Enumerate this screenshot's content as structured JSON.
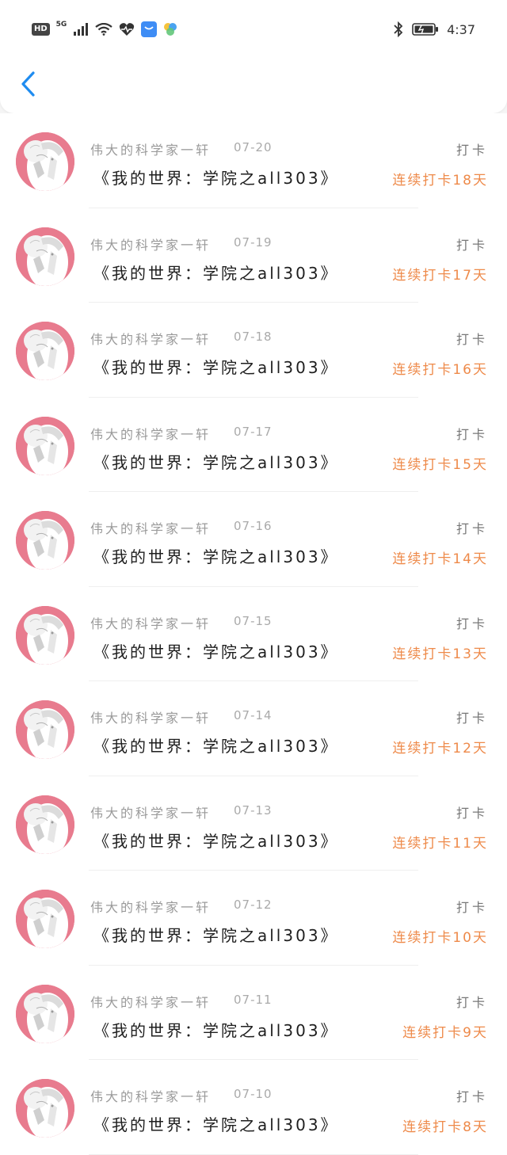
{
  "status_bar": {
    "hd": "HD",
    "network": "5G",
    "time": "4:37"
  },
  "colors": {
    "accent_blue": "#1f8cf0",
    "streak_orange": "#ee8a4a",
    "avatar_pink": "#e87b8e"
  },
  "icons": {
    "back": "chevron-left-icon",
    "avatar": "avatar"
  },
  "checkins": [
    {
      "author": "伟大的科学家一轩",
      "date": "07-20",
      "title": "《我的世界：学院之all303》",
      "action": "打卡",
      "streak": "连续打卡18天"
    },
    {
      "author": "伟大的科学家一轩",
      "date": "07-19",
      "title": "《我的世界：学院之all303》",
      "action": "打卡",
      "streak": "连续打卡17天"
    },
    {
      "author": "伟大的科学家一轩",
      "date": "07-18",
      "title": "《我的世界：学院之all303》",
      "action": "打卡",
      "streak": "连续打卡16天"
    },
    {
      "author": "伟大的科学家一轩",
      "date": "07-17",
      "title": "《我的世界：学院之all303》",
      "action": "打卡",
      "streak": "连续打卡15天"
    },
    {
      "author": "伟大的科学家一轩",
      "date": "07-16",
      "title": "《我的世界：学院之all303》",
      "action": "打卡",
      "streak": "连续打卡14天"
    },
    {
      "author": "伟大的科学家一轩",
      "date": "07-15",
      "title": "《我的世界：学院之all303》",
      "action": "打卡",
      "streak": "连续打卡13天"
    },
    {
      "author": "伟大的科学家一轩",
      "date": "07-14",
      "title": "《我的世界：学院之all303》",
      "action": "打卡",
      "streak": "连续打卡12天"
    },
    {
      "author": "伟大的科学家一轩",
      "date": "07-13",
      "title": "《我的世界：学院之all303》",
      "action": "打卡",
      "streak": "连续打卡11天"
    },
    {
      "author": "伟大的科学家一轩",
      "date": "07-12",
      "title": "《我的世界：学院之all303》",
      "action": "打卡",
      "streak": "连续打卡10天"
    },
    {
      "author": "伟大的科学家一轩",
      "date": "07-11",
      "title": "《我的世界：学院之all303》",
      "action": "打卡",
      "streak": "连续打卡9天"
    },
    {
      "author": "伟大的科学家一轩",
      "date": "07-10",
      "title": "《我的世界：学院之all303》",
      "action": "打卡",
      "streak": "连续打卡8天"
    }
  ]
}
